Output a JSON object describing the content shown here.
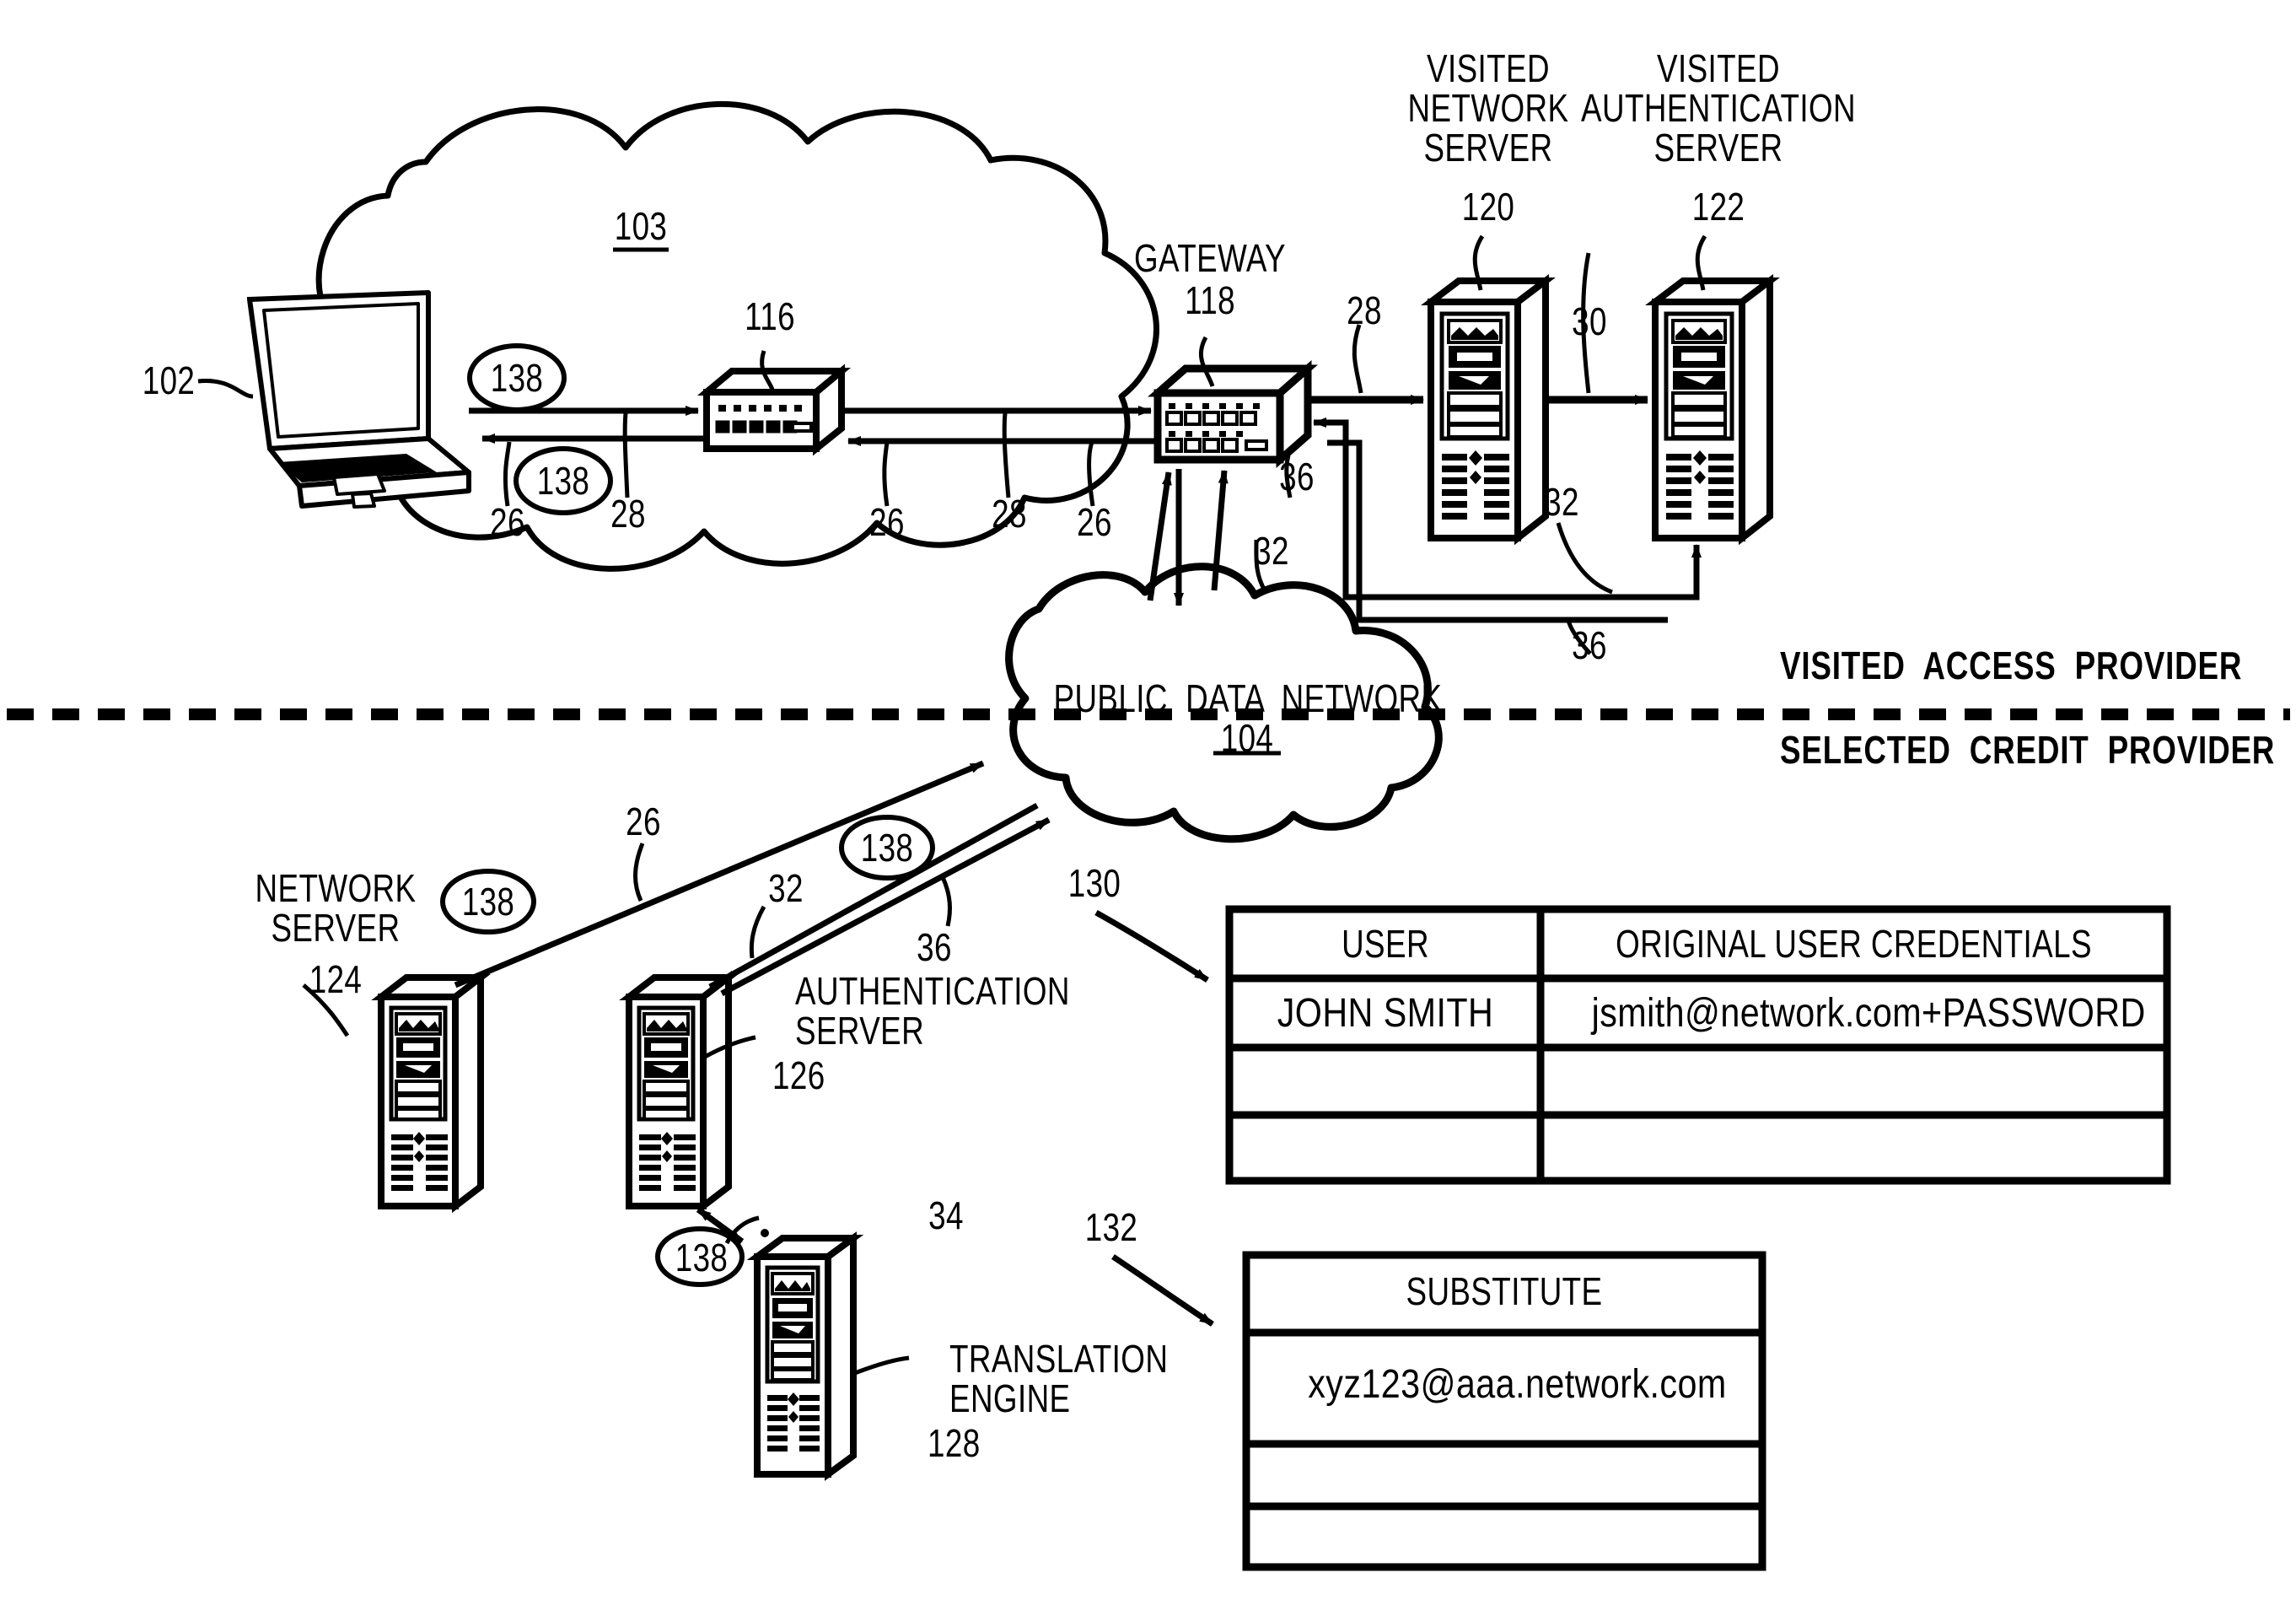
{
  "figure": {
    "type": "patent-network-diagram",
    "divider": {
      "above_label": "VISITED  ACCESS  PROVIDER",
      "below_label": "SELECTED  CREDIT  PROVIDER",
      "style": "dashed"
    }
  },
  "nodes": {
    "laptop": {
      "ref": "102",
      "label": ""
    },
    "visited_cloud": {
      "ref": "103",
      "label": ""
    },
    "switch": {
      "ref": "116",
      "label": ""
    },
    "gateway": {
      "ref": "118",
      "label": "GATEWAY"
    },
    "visited_network_server": {
      "ref": "120",
      "label": "VISITED\nNETWORK\nSERVER"
    },
    "visited_auth_server": {
      "ref": "122",
      "label": "VISITED\nAUTHENTICATION\nSERVER"
    },
    "public_data_network": {
      "ref": "104",
      "label": "PUBLIC  DATA  NETWORK"
    },
    "network_server": {
      "ref": "124",
      "label": "NETWORK\nSERVER"
    },
    "authentication_server": {
      "ref": "126",
      "label": "AUTHENTICATION\nSERVER"
    },
    "translation_engine": {
      "ref": "128",
      "label": "TRANSLATION\nENGINE"
    },
    "credentials_table": {
      "ref": "130"
    },
    "substitute_table": {
      "ref": "132"
    }
  },
  "flow_refs": {
    "r26": "26",
    "r28": "28",
    "r30": "30",
    "r32": "32",
    "r34": "34",
    "r36": "36",
    "r138": "138"
  },
  "tables": {
    "credentials": {
      "ref": "130",
      "headers": [
        "USER",
        "ORIGINAL USER CREDENTIALS"
      ],
      "rows": [
        [
          "JOHN SMITH",
          "jsmith@network.com+PASSWORD"
        ],
        [
          "",
          ""
        ],
        [
          "",
          ""
        ]
      ]
    },
    "substitute": {
      "ref": "132",
      "headers": [
        "SUBSTITUTE"
      ],
      "rows": [
        [
          "xyz123@aaa.network.com"
        ],
        [
          ""
        ],
        [
          ""
        ]
      ]
    }
  },
  "colors": {
    "ink": "#000000",
    "paper": "#ffffff"
  }
}
